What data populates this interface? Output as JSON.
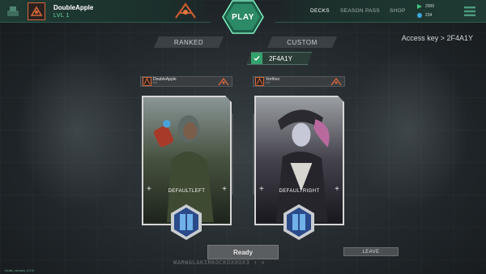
{
  "player": {
    "name": "DoubleApple",
    "level": "LVL 1"
  },
  "play_label": "PLAY",
  "nav": {
    "decks": "DECKS",
    "season_pass": "SEASON PASS",
    "shop": "SHOP"
  },
  "currency": [
    {
      "icon": "play-coin-icon",
      "value": "2000",
      "color": "#3ec67d"
    },
    {
      "icon": "gem-icon",
      "value": "234",
      "color": "#3aa7e0"
    }
  ],
  "modes": {
    "ranked": "RANKED",
    "custom": "CUSTOM"
  },
  "lobby_key": "2F4A1Y",
  "access_key_text": "Access key > 2F4A1Y",
  "players": [
    {
      "name": "DoubleApple",
      "lvl": "Lvl",
      "deck": "DEFAULTLEFT"
    },
    {
      "name": "Vorthos",
      "lvl": "Lvl",
      "deck": "DEFAULTRIGHT"
    }
  ],
  "ready_label": "Ready",
  "leave_label": "LEAVE",
  "deco_text": "WARWALAKIRKOCKOXOOX3 ↑ ✕",
  "build": "../build_version_0.0.0",
  "colors": {
    "accent": "#34a26c",
    "brand_orange": "#d4673a",
    "level_green": "#6fe0a8"
  }
}
